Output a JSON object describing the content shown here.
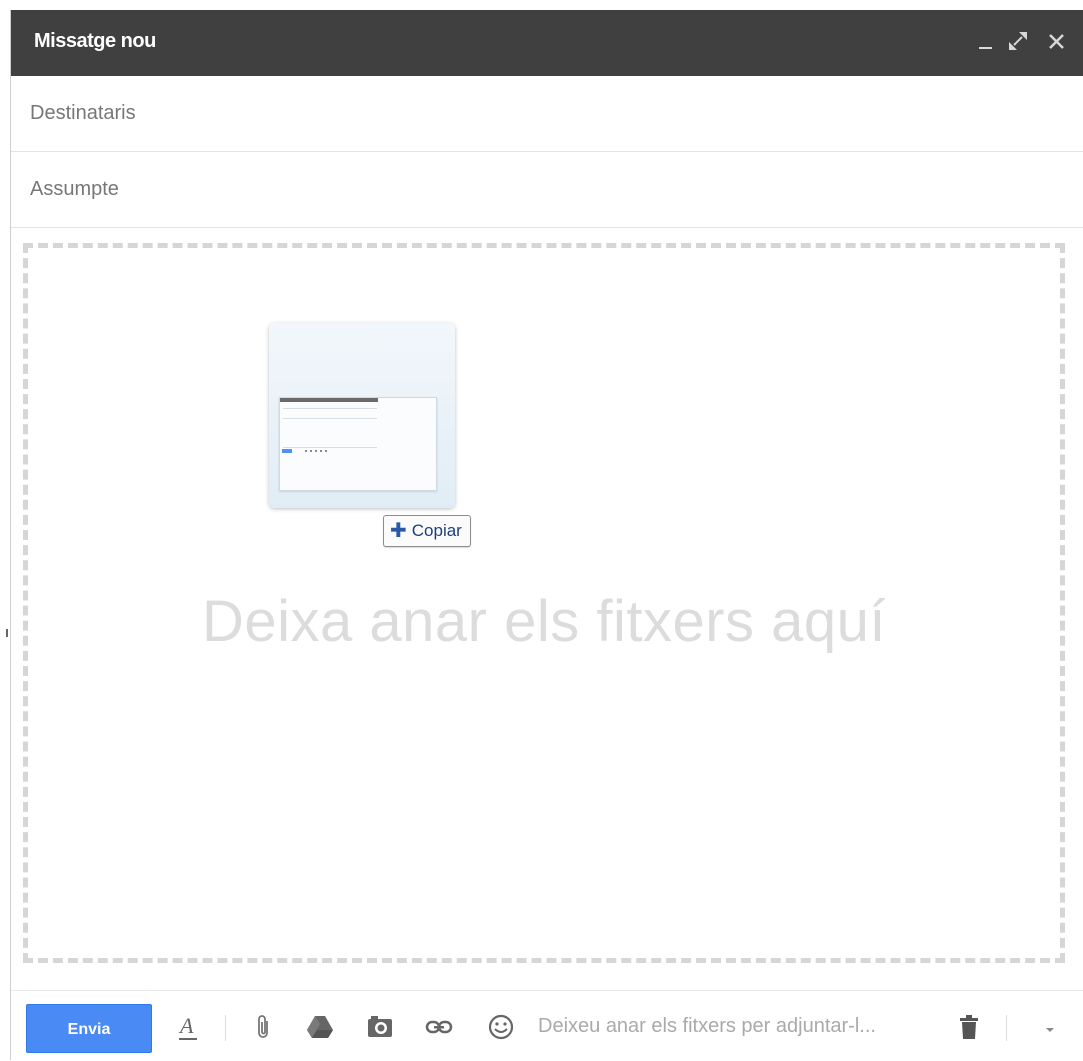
{
  "window": {
    "title": "Missatge nou",
    "controls": [
      "minimize-icon",
      "expand-icon",
      "close-icon"
    ]
  },
  "fields": {
    "to_placeholder": "Destinataris",
    "subject_placeholder": "Assumpte"
  },
  "dropzone": {
    "text": "Deixa anar els fitxers aquí",
    "drag_badge": "Copiar"
  },
  "toolbar": {
    "send_label": "Envia",
    "format_label": "A",
    "attach_hint": "Deixeu anar els fitxers per adjuntar-l...",
    "icons": [
      "formatting-icon",
      "attach-icon",
      "drive-icon",
      "photo-icon",
      "link-icon",
      "emoji-icon",
      "trash-icon",
      "more-options-icon"
    ]
  },
  "colors": {
    "titlebar": "#404040",
    "send_button": "#4a8af4",
    "drop_border": "#d6d6d6",
    "drop_text": "#dcdcdc"
  }
}
